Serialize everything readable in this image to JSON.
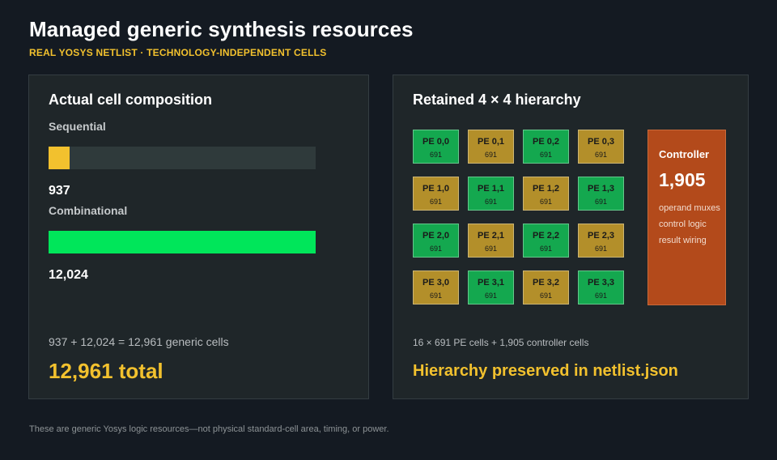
{
  "header": {
    "title": "Managed generic synthesis resources",
    "subtitle": "REAL YOSYS NETLIST · TECHNOLOGY-INDEPENDENT CELLS"
  },
  "composition": {
    "title": "Actual cell composition",
    "rows": [
      {
        "label": "Sequential",
        "value": 937,
        "value_text": "937",
        "color": "#f2c12e"
      },
      {
        "label": "Combinational",
        "value": 12024,
        "value_text": "12,024",
        "color": "#00e65a"
      }
    ],
    "bar_max": 12024,
    "track_color": "#2f3a3b",
    "equation": "937 + 12,024 = 12,961 generic cells",
    "total": "12,961 total"
  },
  "hierarchy": {
    "title": "Retained 4 × 4 hierarchy",
    "pe_grid": [
      [
        {
          "name": "PE 0,0",
          "count": "691",
          "color": "green"
        },
        {
          "name": "PE 0,1",
          "count": "691",
          "color": "gold"
        },
        {
          "name": "PE 0,2",
          "count": "691",
          "color": "green"
        },
        {
          "name": "PE 0,3",
          "count": "691",
          "color": "gold"
        }
      ],
      [
        {
          "name": "PE 1,0",
          "count": "691",
          "color": "gold"
        },
        {
          "name": "PE 1,1",
          "count": "691",
          "color": "green"
        },
        {
          "name": "PE 1,2",
          "count": "691",
          "color": "gold"
        },
        {
          "name": "PE 1,3",
          "count": "691",
          "color": "green"
        }
      ],
      [
        {
          "name": "PE 2,0",
          "count": "691",
          "color": "green"
        },
        {
          "name": "PE 2,1",
          "count": "691",
          "color": "gold"
        },
        {
          "name": "PE 2,2",
          "count": "691",
          "color": "green"
        },
        {
          "name": "PE 2,3",
          "count": "691",
          "color": "gold"
        }
      ],
      [
        {
          "name": "PE 3,0",
          "count": "691",
          "color": "gold"
        },
        {
          "name": "PE 3,1",
          "count": "691",
          "color": "green"
        },
        {
          "name": "PE 3,2",
          "count": "691",
          "color": "gold"
        },
        {
          "name": "PE 3,3",
          "count": "691",
          "color": "green"
        }
      ]
    ],
    "controller": {
      "title": "Controller",
      "value": "1,905",
      "lines": [
        "operand muxes",
        "control logic",
        "result wiring"
      ]
    },
    "note": "16 × 691 PE cells + 1,905 controller cells",
    "highlight": "Hierarchy preserved in netlist.json"
  },
  "footer": "These are generic Yosys logic resources—not physical standard-cell area, timing, or power."
}
